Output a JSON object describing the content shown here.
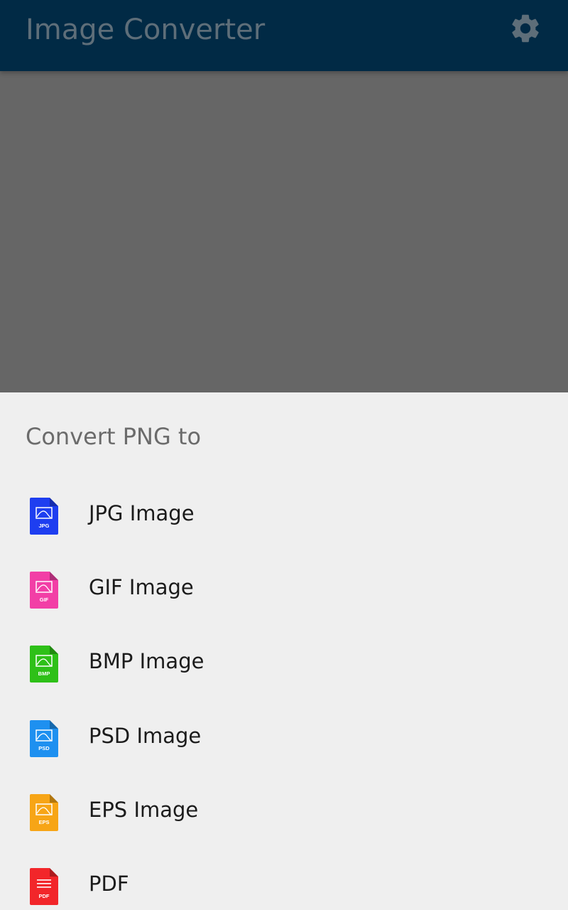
{
  "app_bar": {
    "title": "Image Converter",
    "settings_icon": "gear-icon",
    "background_color": "#012a45"
  },
  "sheet": {
    "title": "Convert PNG to",
    "options": [
      {
        "label": "JPG Image",
        "badge": "JPG",
        "icon": "jpg-file-icon",
        "color": "#1e3ef0"
      },
      {
        "label": "GIF Image",
        "badge": "GIF",
        "icon": "gif-file-icon",
        "color": "#f23fa6"
      },
      {
        "label": "BMP Image",
        "badge": "BMP",
        "icon": "bmp-file-icon",
        "color": "#2ec018"
      },
      {
        "label": "PSD Image",
        "badge": "PSD",
        "icon": "psd-file-icon",
        "color": "#1e90f0"
      },
      {
        "label": "EPS Image",
        "badge": "EPS",
        "icon": "eps-file-icon",
        "color": "#f7a516"
      },
      {
        "label": "PDF",
        "badge": "PDF",
        "icon": "pdf-file-icon",
        "color": "#f2262a"
      }
    ]
  }
}
